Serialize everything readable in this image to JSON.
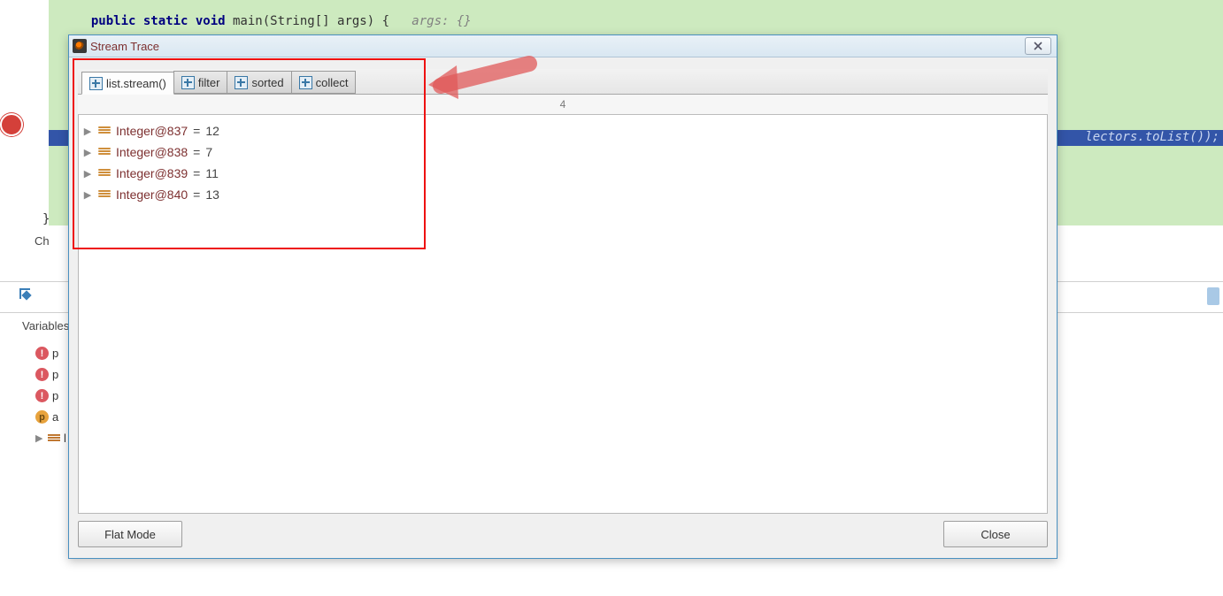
{
  "editor": {
    "code_kw1": "public static void",
    "code_mid": " main(String[] args) {   ",
    "code_cm": "args: {}",
    "runline_tail": "lectors.toList());",
    "brace": "}",
    "ch_label": "Ch",
    "variables_label": "Variables"
  },
  "sidebar_rows": [
    {
      "kind": "err",
      "letter": "!",
      "txt": "p"
    },
    {
      "kind": "err",
      "letter": "!",
      "txt": "p"
    },
    {
      "kind": "err",
      "letter": "!",
      "txt": "p"
    },
    {
      "kind": "warn",
      "letter": "p",
      "txt": "a"
    },
    {
      "kind": "list",
      "txt": "l"
    }
  ],
  "dialog": {
    "title": "Stream Trace",
    "tabs": [
      {
        "label": "list.stream()",
        "active": true
      },
      {
        "label": "filter",
        "active": false
      },
      {
        "label": "sorted",
        "active": false
      },
      {
        "label": "collect",
        "active": false
      }
    ],
    "count_header": "4",
    "items": [
      {
        "name": "Integer@837",
        "value": "12"
      },
      {
        "name": "Integer@838",
        "value": "7"
      },
      {
        "name": "Integer@839",
        "value": "11"
      },
      {
        "name": "Integer@840",
        "value": "13"
      }
    ],
    "flat_mode_label": "Flat Mode",
    "close_label": "Close"
  }
}
